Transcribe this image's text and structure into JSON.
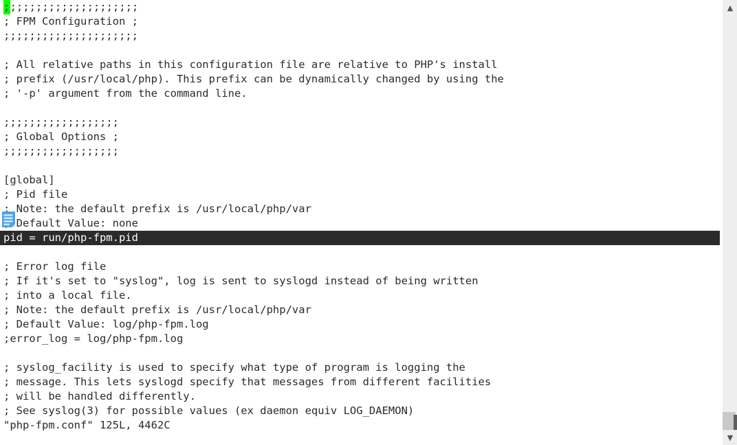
{
  "window": {
    "app": "vim",
    "file_name": "php-fpm.conf"
  },
  "editor": {
    "cursor_char": ";",
    "cursor_color": "#00ff00",
    "text_color": "#2b2b2b",
    "background": "#ffffff",
    "highlight_background": "#2b2b2b",
    "highlight_foreground": "#ffffff",
    "sign_icon": "note-document-icon",
    "lines": [
      {
        "text": ";;;;;;;;;;;;;;;;;;;;;",
        "cursor": true
      },
      {
        "text": "; FPM Configuration ;"
      },
      {
        "text": ";;;;;;;;;;;;;;;;;;;;;"
      },
      {
        "text": ""
      },
      {
        "text": "; All relative paths in this configuration file are relative to PHP's install"
      },
      {
        "text": "; prefix (/usr/local/php). This prefix can be dynamically changed by using the"
      },
      {
        "text": "; '-p' argument from the command line."
      },
      {
        "text": ""
      },
      {
        "text": ";;;;;;;;;;;;;;;;;;"
      },
      {
        "text": "; Global Options ;"
      },
      {
        "text": ";;;;;;;;;;;;;;;;;;"
      },
      {
        "text": ""
      },
      {
        "text": "[global]"
      },
      {
        "text": "; Pid file"
      },
      {
        "text": "; Note: the default prefix is /usr/local/php/var"
      },
      {
        "text": "; Default Value: none"
      },
      {
        "text": "pid = run/php-fpm.pid",
        "highlight": true
      },
      {
        "text": ""
      },
      {
        "text": "; Error log file"
      },
      {
        "text": "; If it's set to \"syslog\", log is sent to syslogd instead of being written"
      },
      {
        "text": "; into a local file."
      },
      {
        "text": "; Note: the default prefix is /usr/local/php/var"
      },
      {
        "text": "; Default Value: log/php-fpm.log"
      },
      {
        "text": ";error_log = log/php-fpm.log"
      },
      {
        "text": ""
      },
      {
        "text": "; syslog_facility is used to specify what type of program is logging the"
      },
      {
        "text": "; message. This lets syslogd specify that messages from different facilities"
      },
      {
        "text": "; will be handled differently."
      },
      {
        "text": "; See syslog(3) for possible values (ex daemon equiv LOG_DAEMON)"
      }
    ]
  },
  "status_line": {
    "text": "\"php-fpm.conf\" 125L, 4462C",
    "file": "php-fpm.conf",
    "lines_count": "125L",
    "chars_count": "4462C"
  },
  "scrollbar": {
    "up_arrow": "chevron-up-icon",
    "down_arrow": "chevron-down-icon",
    "track_color": "#eeeeee",
    "thumb_color": "#c9c9c9"
  }
}
